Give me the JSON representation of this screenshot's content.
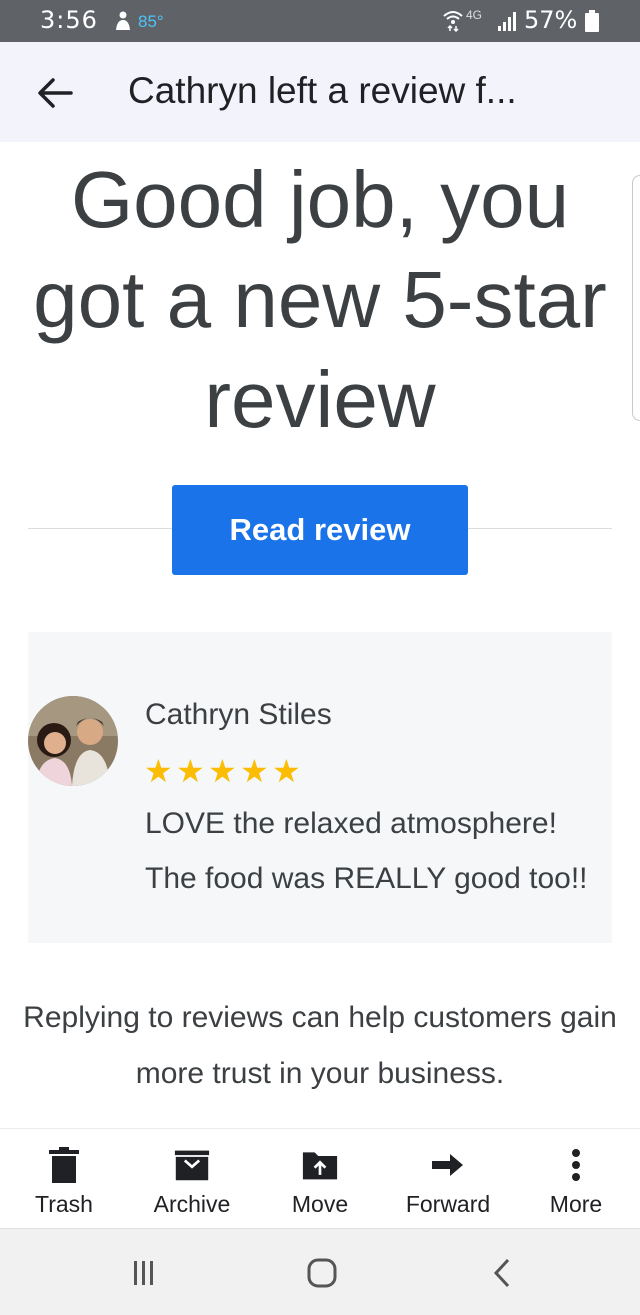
{
  "status_bar": {
    "time": "3:56",
    "temperature": "85°",
    "network": "4G",
    "battery": "57%"
  },
  "app_bar": {
    "title": "Cathryn left a review f..."
  },
  "email": {
    "headline": "Good job, you got a new 5-star review",
    "read_button": "Read review",
    "review": {
      "reviewer": "Cathryn Stiles",
      "rating": 5,
      "text": "LOVE the relaxed atmosphere! The food was REALLY good too!!"
    },
    "info": "Replying to reviews can help customers gain more trust in your business."
  },
  "actions": [
    {
      "label": "Trash",
      "icon": "trash-icon"
    },
    {
      "label": "Archive",
      "icon": "archive-icon"
    },
    {
      "label": "Move",
      "icon": "move-icon"
    },
    {
      "label": "Forward",
      "icon": "forward-icon"
    },
    {
      "label": "More",
      "icon": "more-vert-icon"
    }
  ],
  "colors": {
    "accent": "#1a73e8",
    "star": "#fbbc04",
    "card_bg": "#f6f7f9",
    "app_bar_bg": "#f3f4fb"
  }
}
